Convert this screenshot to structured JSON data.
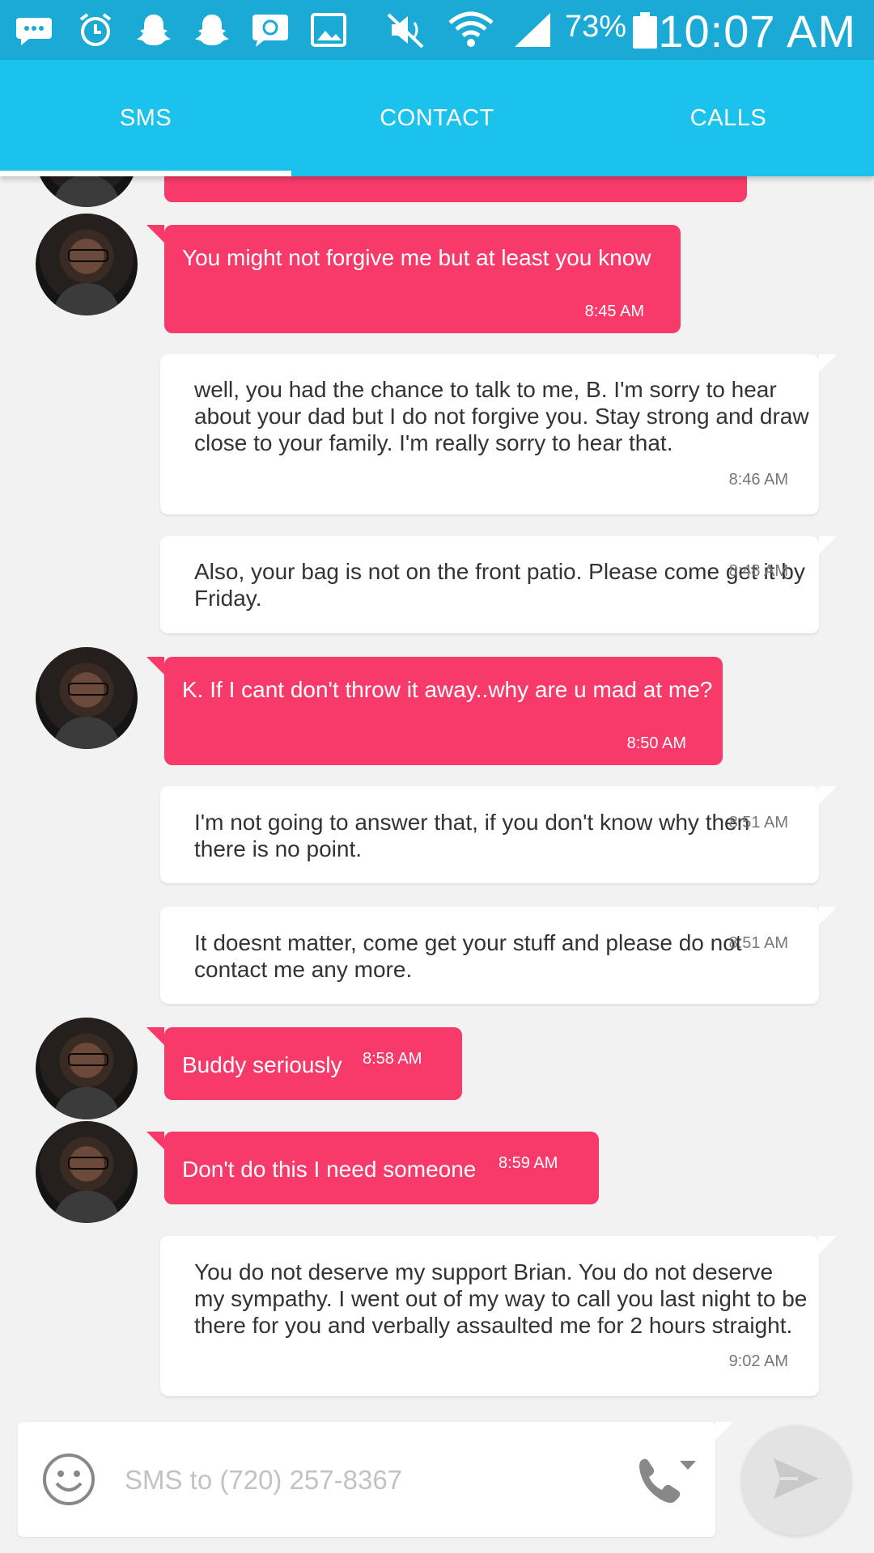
{
  "status_bar": {
    "battery_percent": "73%",
    "time": "10:07 AM",
    "icons": [
      "more-messages-icon",
      "alarm-icon",
      "snapchat-icon",
      "snapchat-icon",
      "chat-app-icon",
      "gallery-icon",
      "mute-icon",
      "wifi-icon",
      "signal-icon",
      "battery-icon"
    ]
  },
  "tabs": [
    {
      "label": "SMS",
      "active": true
    },
    {
      "label": "CONTACT",
      "active": false
    },
    {
      "label": "CALLS",
      "active": false
    }
  ],
  "messages": [
    {
      "dir": "in",
      "text": "You might not forgive me but at least you know",
      "time": "8:45 AM"
    },
    {
      "dir": "out",
      "text": "well, you had the chance to talk to me, B. I'm sorry to hear about your dad but I do not forgive you. Stay strong and draw close to your family. I'm really sorry to hear that.",
      "time": "8:46 AM"
    },
    {
      "dir": "out",
      "text": "Also, your bag is not on the front patio. Please come get it by Friday.",
      "time": "8:48 AM"
    },
    {
      "dir": "in",
      "text": "K. If I cant don't throw it away..why are u mad at me?",
      "time": "8:50 AM"
    },
    {
      "dir": "out",
      "text": "I'm not going to answer that, if you don't know why then there is no point.",
      "time": "8:51 AM"
    },
    {
      "dir": "out",
      "text": "It doesnt matter, come get your stuff and please do not contact me any more.",
      "time": "8:51 AM"
    },
    {
      "dir": "in",
      "text": "Buddy seriously",
      "time": "8:58 AM"
    },
    {
      "dir": "in",
      "text": "Don't do this I need someone",
      "time": "8:59 AM"
    },
    {
      "dir": "out",
      "text": "You do not deserve my support Brian. You do not deserve my sympathy. I went out of my way to call you last night to be there for you and verbally assaulted me for 2 hours straight.",
      "time": "9:02 AM"
    }
  ],
  "composer": {
    "placeholder": "SMS to (720) 257-8367",
    "value": ""
  },
  "colors": {
    "status_bar": "#1ba9d6",
    "tab_bar": "#1bc3ec",
    "incoming_bubble": "#f73a6a",
    "outgoing_bubble": "#ffffff",
    "background": "#f2f2f2"
  }
}
